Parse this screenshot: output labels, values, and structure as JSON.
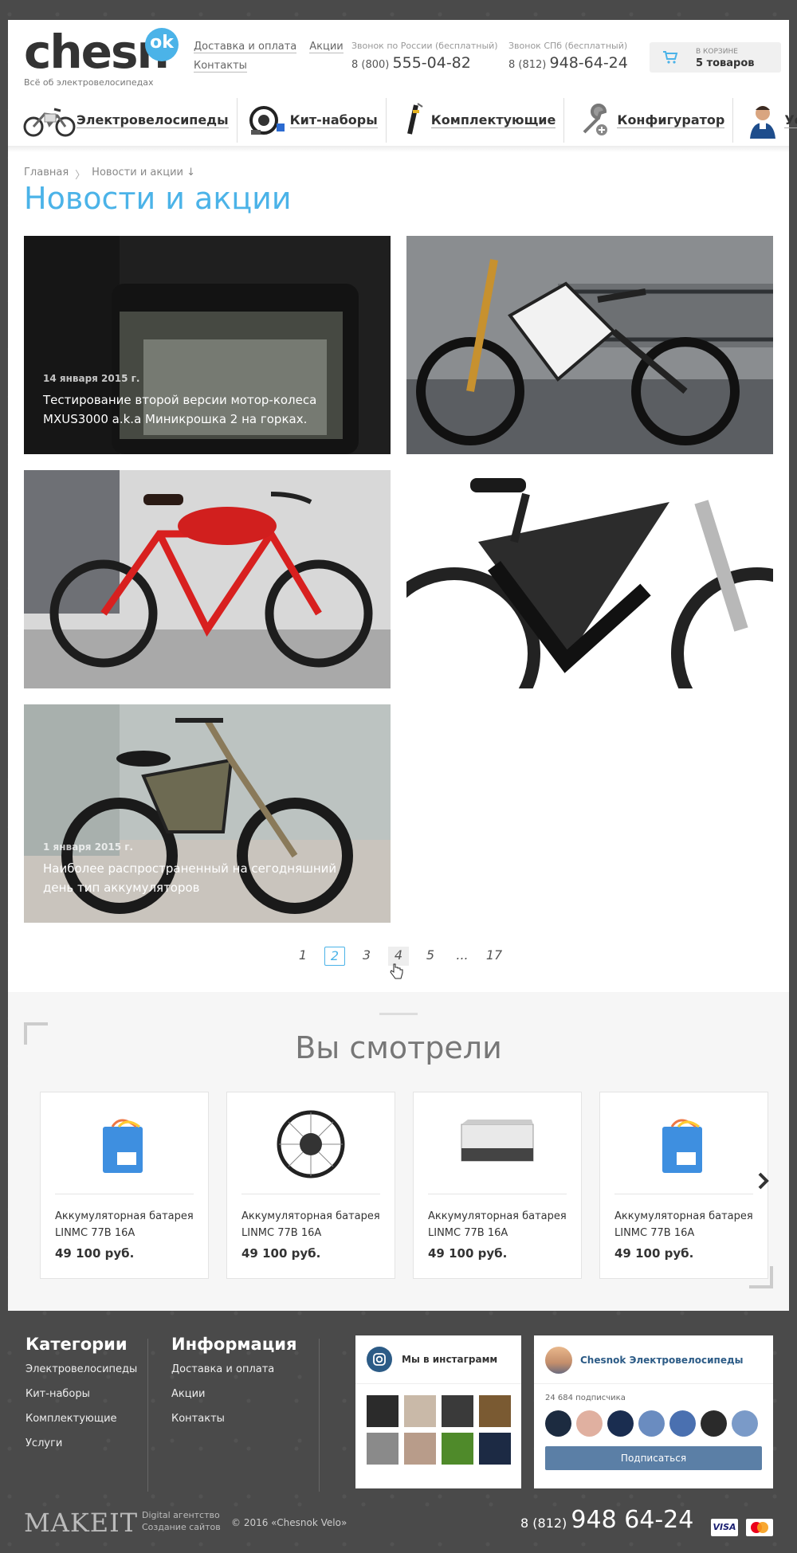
{
  "header": {
    "logo_text": "chesn",
    "logo_badge": "ok",
    "logo_sub": "Всё об электровелосипедах",
    "links": [
      "Доставка и оплата",
      "Акции",
      "Контакты"
    ],
    "phone_ru_label": "Звонок по России (бесплатный)",
    "phone_ru_code": "8 (800)",
    "phone_ru_number": "555-04-82",
    "phone_spb_label": "Звонок СПб (бесплатный)",
    "phone_spb_code": "8 (812)",
    "phone_spb_number": "948-64-24",
    "cart_label": "в корзине",
    "cart_count": "5 товаров"
  },
  "nav": [
    {
      "label": "Электровелосипеды",
      "icon": "ebike-icon"
    },
    {
      "label": "Кит-наборы",
      "icon": "wheel-kit-icon"
    },
    {
      "label": "Комплектующие",
      "icon": "component-icon"
    },
    {
      "label": "Конфигуратор",
      "icon": "wrench-icon"
    },
    {
      "label": "Услуги",
      "icon": "mechanic-icon"
    }
  ],
  "breadcrumb": [
    "Главная",
    "Новости и акции ↓"
  ],
  "page_title": "Новости и акции",
  "news": [
    {
      "date": "14 января 2015 г.",
      "caption": "Тестирование второй версии мотор-колеса MXUS3000 a.k.a Миникрошка 2 на горках."
    },
    {
      "date": "",
      "caption": ""
    },
    {
      "date": "",
      "caption": ""
    },
    {
      "date": "",
      "caption": ""
    },
    {
      "date": "1 января 2015 г.",
      "caption": "Наиболее распространенный на сегодняшний день тип аккумуляторов"
    }
  ],
  "pager": [
    "1",
    "2",
    "3",
    "4",
    "5",
    "...",
    "17"
  ],
  "viewed": {
    "title": "Вы смотрели",
    "products": [
      {
        "name": "Аккумуляторная батарея LINMC 77B 16A",
        "price": "49 100 руб."
      },
      {
        "name": "Аккумуляторная батарея LINMC 77B 16A",
        "price": "49 100 руб."
      },
      {
        "name": "Аккумуляторная батарея LINMC 77B 16A",
        "price": "49 100 руб."
      },
      {
        "name": "Аккумуляторная батарея LINMC 77B 16A",
        "price": "49 100 руб."
      }
    ]
  },
  "footer": {
    "categories_title": "Категории",
    "categories": [
      "Электровелосипеды",
      "Кит-наборы",
      "Комплектующие",
      "Услуги"
    ],
    "info_title": "Информация",
    "info": [
      "Доставка и оплата",
      "Акции",
      "Контакты"
    ],
    "instagram_title": "Мы в инстаграмм",
    "vk_name": "Chesnok Электровелосипеды",
    "vk_subscribers": "24 684 подписчика",
    "vk_button": "Подписаться",
    "makeit": "MAKEIT",
    "makeit_sub1": "Digital агентство",
    "makeit_sub2": "Создание сайтов",
    "copyright": "© 2016 «Chesnok Velo»",
    "phone_code": "8 (812)",
    "phone_number": "948 64-24",
    "visa": "VISA"
  },
  "colors": {
    "accent": "#4bb3e8",
    "vk": "#5b7fa6"
  }
}
